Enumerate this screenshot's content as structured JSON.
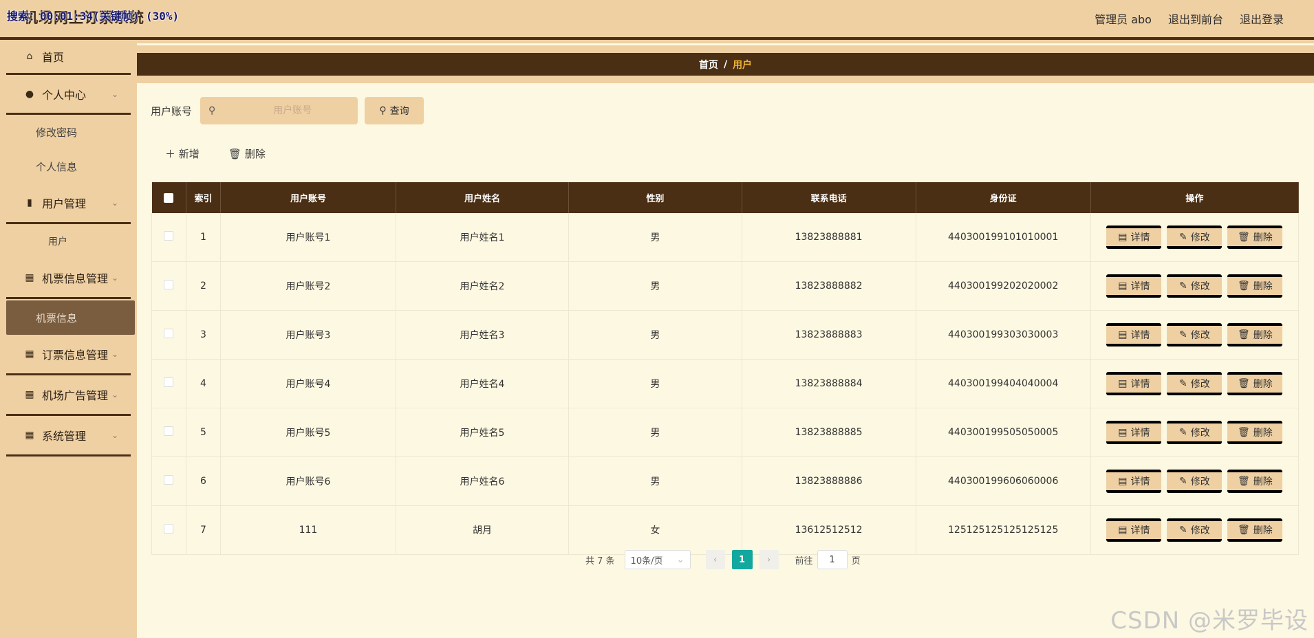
{
  "app": {
    "title": "机场网上订票系统",
    "overlay": "搜索：00:01:34(关键帧) (30%)"
  },
  "header": {
    "admin": "管理员 abo",
    "to_front": "退出到前台",
    "logout": "退出登录"
  },
  "sidebar": {
    "home": "首页",
    "personal": "个人中心",
    "change_pwd": "修改密码",
    "personal_info": "个人信息",
    "user_mgmt": "用户管理",
    "user": "用户",
    "ticket_mgmt": "机票信息管理",
    "ticket_info": "机票信息",
    "booking_mgmt": "订票信息管理",
    "ad_mgmt": "机场广告管理",
    "sys_mgmt": "系统管理"
  },
  "breadcrumb": {
    "home": "首页",
    "sep": "/",
    "current": "用户"
  },
  "search": {
    "label": "用户账号",
    "placeholder": "用户账号",
    "value": "",
    "button": "查询"
  },
  "actions": {
    "add": "新增",
    "delete": "删除"
  },
  "table": {
    "headers": {
      "index": "索引",
      "account": "用户账号",
      "name": "用户姓名",
      "gender": "性别",
      "phone": "联系电话",
      "id_card": "身份证",
      "ops": "操作"
    },
    "op_labels": {
      "detail": "详情",
      "edit": "修改",
      "delete": "删除"
    },
    "rows": [
      {
        "index": "1",
        "account": "用户账号1",
        "name": "用户姓名1",
        "gender": "男",
        "phone": "13823888881",
        "id_card": "440300199101010001"
      },
      {
        "index": "2",
        "account": "用户账号2",
        "name": "用户姓名2",
        "gender": "男",
        "phone": "13823888882",
        "id_card": "440300199202020002"
      },
      {
        "index": "3",
        "account": "用户账号3",
        "name": "用户姓名3",
        "gender": "男",
        "phone": "13823888883",
        "id_card": "440300199303030003"
      },
      {
        "index": "4",
        "account": "用户账号4",
        "name": "用户姓名4",
        "gender": "男",
        "phone": "13823888884",
        "id_card": "440300199404040004"
      },
      {
        "index": "5",
        "account": "用户账号5",
        "name": "用户姓名5",
        "gender": "男",
        "phone": "13823888885",
        "id_card": "440300199505050005"
      },
      {
        "index": "6",
        "account": "用户账号6",
        "name": "用户姓名6",
        "gender": "男",
        "phone": "13823888886",
        "id_card": "440300199606060006"
      },
      {
        "index": "7",
        "account": "111",
        "name": "胡月",
        "gender": "女",
        "phone": "13612512512",
        "id_card": "125125125125125125"
      }
    ]
  },
  "pagination": {
    "total": "共 7 条",
    "page_size": "10条/页",
    "current_page": "1",
    "goto_label": "前往",
    "goto_value": "1",
    "page_unit": "页"
  },
  "watermark": "CSDN @米罗毕设",
  "colors": {
    "sidebar_bg": "#efd0a3",
    "dark_brown": "#4a2f14",
    "page_bg": "#fdf8e1",
    "accent_teal": "#13a89e",
    "breadcrumb_current": "#f2b233"
  }
}
